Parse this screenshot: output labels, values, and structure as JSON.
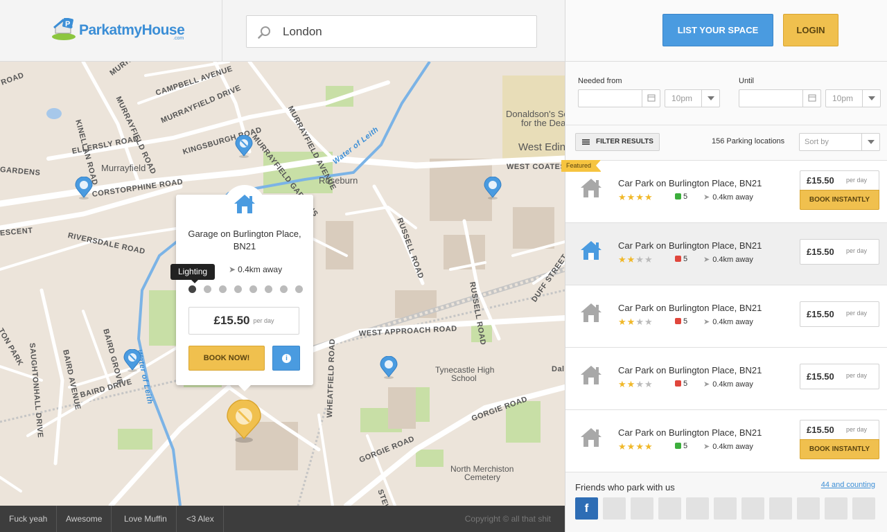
{
  "header": {
    "logo_text_a": "Parkat",
    "logo_text_b": "myHouse",
    "logo_com": ".com",
    "search_value": "London"
  },
  "map": {
    "labels": [
      {
        "text": "MURRAYFIELD AVENUE"
      },
      {
        "text": "CAMPBELL AVENUE"
      },
      {
        "text": "MURRAYFIELD DRIVE"
      },
      {
        "text": "KINGSBURGH ROAD"
      },
      {
        "text": "MURRAYFIELD GARDENS"
      },
      {
        "text": "MURRAYFIELD AVENUE"
      },
      {
        "text": "MURRAYFIELD ROAD"
      },
      {
        "text": "KINELLAN ROAD"
      },
      {
        "text": "ELLERSLY ROAD"
      },
      {
        "text": "Murrayfield"
      },
      {
        "text": "CORSTORPHINE ROAD"
      },
      {
        "text": "Roseburn"
      },
      {
        "text": "WEST COATES"
      },
      {
        "text": "Donaldson's School"
      },
      {
        "text": "for the Deaf"
      },
      {
        "text": "West Edin"
      },
      {
        "text": "RIVERSDALE ROAD"
      },
      {
        "text": "RUSSELL ROAD"
      },
      {
        "text": "RUSSELL ROAD"
      },
      {
        "text": "SAUGHTONHALL DRIVE"
      },
      {
        "text": "BAIRD AVENUE"
      },
      {
        "text": "BAIRD GROVE"
      },
      {
        "text": "BAIRD DRIVE"
      },
      {
        "text": "WEST APPROACH ROAD"
      },
      {
        "text": "Tynecastle High"
      },
      {
        "text": "School"
      },
      {
        "text": "GORGIE ROAD"
      },
      {
        "text": "GORGIE ROAD"
      },
      {
        "text": "North Merchiston"
      },
      {
        "text": "Cemetery"
      },
      {
        "text": "WHEATFIELD ROAD"
      },
      {
        "text": "Water of Leith"
      },
      {
        "text": "Water of Leith"
      },
      {
        "text": "DUFF STREET"
      },
      {
        "text": "GARDENS"
      },
      {
        "text": "ESCENT"
      },
      {
        "text": "ROAD"
      },
      {
        "text": "TON PARK"
      },
      {
        "text": "STEWART"
      },
      {
        "text": "Dal"
      }
    ],
    "popup": {
      "title": "Garage on Burlington Place, BN21",
      "distance": "0.4km away",
      "tooltip": "Lighting",
      "price": "£15.50",
      "per_day": "per day",
      "book_label": "BOOK NOW!",
      "info_label": "i"
    }
  },
  "footer": {
    "links": [
      "Fuck yeah",
      "Awesome",
      "Love Muffin",
      "<3 Alex"
    ],
    "copyright": "Copyright © all that shit"
  },
  "sidebar": {
    "list_space_label": "LIST YOUR SPACE",
    "login_label": "LOGIN",
    "needed_from_label": "Needed from",
    "until_label": "Until",
    "from_time": "10pm",
    "until_time": "10pm",
    "filter_label": "FILTER RESULTS",
    "count_text": "156 Parking locations",
    "sort_placeholder": "Sort by",
    "featured_label": "Featured",
    "results": [
      {
        "name": "Car Park on Burlington Place, BN21",
        "rating": 4,
        "votes": "5",
        "vote_type": "up",
        "distance": "0.4km away",
        "price": "£15.50",
        "per_day": "per day",
        "book_label": "BOOK INSTANTLY",
        "featured": true,
        "selected": false
      },
      {
        "name": "Car Park on Burlington Place, BN21",
        "rating": 2,
        "votes": "5",
        "vote_type": "down",
        "distance": "0.4km away",
        "price": "£15.50",
        "per_day": "per day",
        "book_label": "",
        "featured": false,
        "selected": true
      },
      {
        "name": "Car Park on Burlington Place, BN21",
        "rating": 2,
        "votes": "5",
        "vote_type": "down",
        "distance": "0.4km away",
        "price": "£15.50",
        "per_day": "per day",
        "book_label": "",
        "featured": false,
        "selected": false
      },
      {
        "name": "Car Park on Burlington Place, BN21",
        "rating": 2,
        "votes": "5",
        "vote_type": "down",
        "distance": "0.4km away",
        "price": "£15.50",
        "per_day": "per day",
        "book_label": "",
        "featured": false,
        "selected": false
      },
      {
        "name": "Car Park on Burlington Place, BN21",
        "rating": 4,
        "votes": "5",
        "vote_type": "up",
        "distance": "0.4km away",
        "price": "£15.50",
        "per_day": "per day",
        "book_label": "BOOK INSTANTLY",
        "featured": false,
        "selected": false
      }
    ],
    "friends_title": "Friends who park with us",
    "friends_count": "44 and counting",
    "facebook_label": "f"
  },
  "colors": {
    "accent_blue": "#4a9be0",
    "accent_yellow": "#f0c04e",
    "vote_up": "#3cae3c",
    "vote_down": "#e0463c",
    "star": "#f0b829"
  }
}
